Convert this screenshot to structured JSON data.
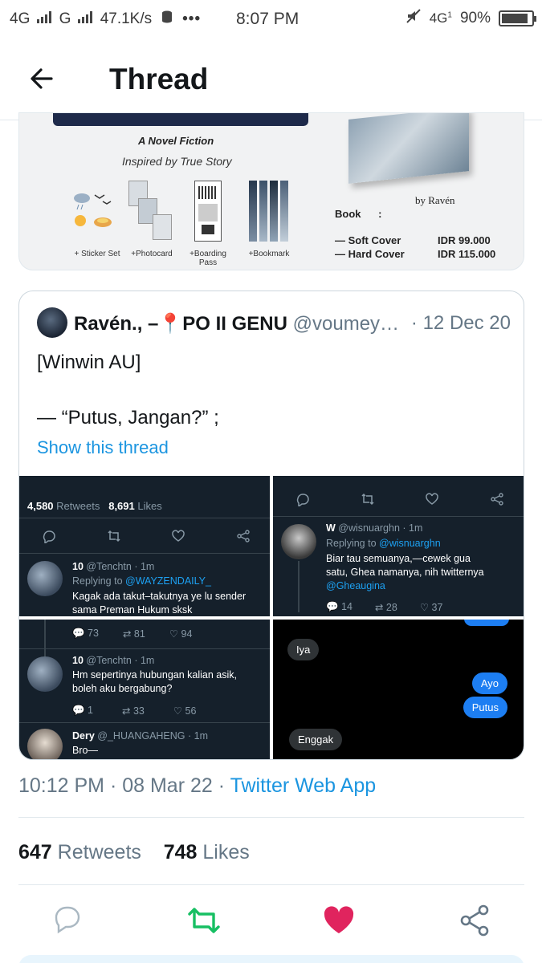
{
  "status_bar": {
    "network1": "4G",
    "network2": "G",
    "speed": "47.1K/s",
    "time": "8:07 PM",
    "network3": "4G",
    "network3_sub": "1",
    "battery": "90%",
    "battery_level": 0.9
  },
  "header": {
    "title": "Thread"
  },
  "promo": {
    "title": "A Novel Fiction",
    "subtitle": "Inspired by True Story",
    "items": [
      "+ Sticker Set",
      "+Photocard",
      "+Boarding Pass",
      "+Bookmark"
    ],
    "author": "by Ravén",
    "book_label": "Book      :",
    "prices": [
      {
        "name": "— Soft Cover",
        "price": "IDR 99.000"
      },
      {
        "name": "— Hard Cover",
        "price": "IDR 115.000"
      }
    ]
  },
  "quoted": {
    "name": "Ravén., –",
    "pin": "📍",
    "name_suffix": "PO II GENU",
    "handle": "@voumey…",
    "date": "· 12 Dec 20",
    "line1": "[Winwin AU]",
    "line2": "— “Putus, Jangan?” ;",
    "show_thread": "Show this thread",
    "media": {
      "cell1": {
        "retweets": "4,580",
        "retweets_label": "Retweets",
        "likes": "8,691",
        "likes_label": "Likes",
        "reply_name": "10",
        "reply_handle": "@Tenchtn · 1m",
        "replying_label": "Replying to",
        "replying_to": "@WAYZENDAILY_",
        "text1": "Kagak ada takut–takutnya ye lu sender",
        "text2": "sama Preman Hukum sksk"
      },
      "cell2": {
        "name": "W",
        "handle": "@wisnuarghn · 1m",
        "replying_label": "Replying to",
        "replying_to": "@wisnuarghn",
        "text1": "Biar tau semuanya,—cewek gua",
        "text2": "satu, Ghea namanya, nih twitternya",
        "mention": "@Gheaugina",
        "c_reply": "14",
        "c_rt": "28",
        "c_like": "37"
      },
      "cell3": {
        "c_reply": "73",
        "c_rt": "81",
        "c_like": "94",
        "name": "10",
        "handle": "@Tenchtn · 1m",
        "text1": "Hm sepertinya hubungan kalian asik,",
        "text2": "boleh aku bergabung?",
        "c2_reply": "1",
        "c2_rt": "33",
        "c2_like": "56",
        "name2": "Dery",
        "handle2": "@_HUANGAHENG · 1m",
        "text3": "Bro—"
      },
      "cell4": {
        "bubble1": "Iya",
        "bubble2": "Ayo",
        "bubble3": "Putus",
        "bubble4": "Enggak"
      }
    }
  },
  "tweet": {
    "time_date": "10:12 PM · 08 Mar 22 · ",
    "source": "Twitter Web App",
    "retweets": "647",
    "retweets_label": "Retweets",
    "likes": "748",
    "likes_label": "Likes"
  },
  "colors": {
    "accent": "#1b95e0",
    "retweet": "#17bf63",
    "like": "#e0245e",
    "dark_bg": "#15202b"
  }
}
